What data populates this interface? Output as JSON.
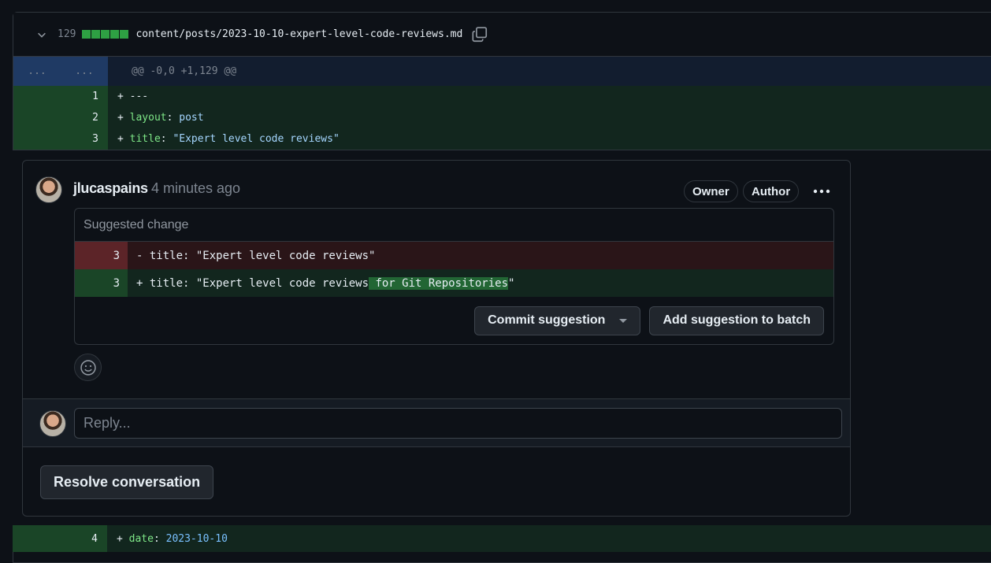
{
  "file": {
    "change_count": "129",
    "path": "content/posts/2023-10-10-expert-level-code-reviews.md"
  },
  "hunk": {
    "left": "...",
    "right": "...",
    "header": "@@ -0,0 +1,129 @@"
  },
  "lines": [
    {
      "num": "1",
      "sign": "+",
      "key": "---",
      "sep": "",
      "value": ""
    },
    {
      "num": "2",
      "sign": "+",
      "key": "layout",
      "sep": ":",
      "value": " post"
    },
    {
      "num": "3",
      "sign": "+",
      "key": "title",
      "sep": ":",
      "value": " \"Expert level code reviews\""
    }
  ],
  "comment": {
    "author": "jlucaspains",
    "time": "4 minutes ago",
    "badges": {
      "owner": "Owner",
      "author": "Author"
    },
    "more_icon": "kebab-horizontal-icon",
    "suggestion": {
      "header": "Suggested change",
      "old_num": "3",
      "old_text": "- title: \"Expert level code reviews\"",
      "new_num": "3",
      "new_prefix": "+ title: \"Expert level code reviews",
      "new_highlight": " for Git Repositories",
      "new_suffix": "\""
    },
    "actions": {
      "commit": "Commit suggestion",
      "batch": "Add suggestion to batch"
    },
    "emoji_icon": "smiley-icon"
  },
  "reply": {
    "placeholder": "Reply..."
  },
  "resolve_label": "Resolve conversation",
  "next_line": {
    "num": "4",
    "sign": "+",
    "key": "date",
    "sep": ":",
    "value": "2023-10-10"
  },
  "colors": {
    "add_bg": "#12261e",
    "add_num_bg": "#1a4527",
    "del_bg": "#2a1518",
    "del_num_bg": "#5c2428",
    "hunk_bg": "#121d2f"
  }
}
